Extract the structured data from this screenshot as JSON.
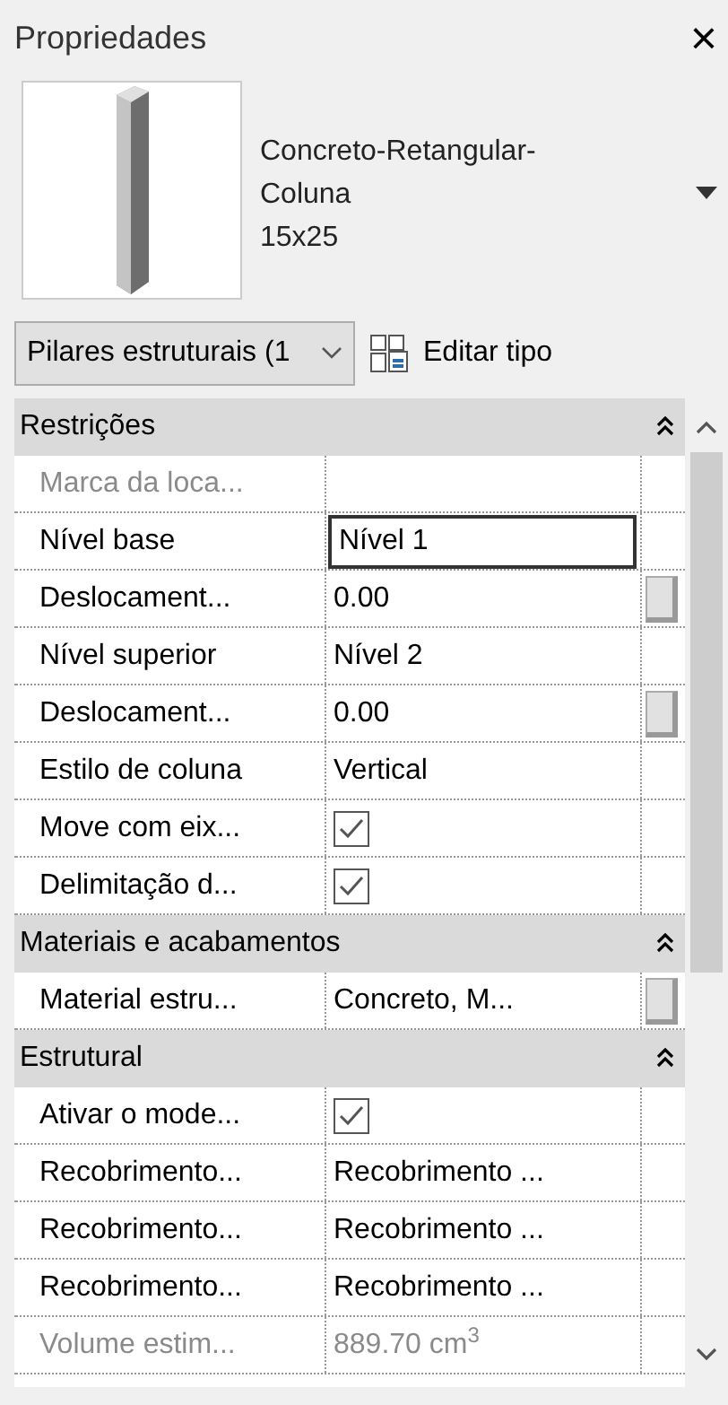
{
  "panel": {
    "title": "Propriedades",
    "close": "×"
  },
  "type_preview": {
    "name": "Concreto-Retangular-Coluna",
    "size": "15x25"
  },
  "selector": {
    "value": "Pilares estruturais (1",
    "edit_type": "Editar tipo"
  },
  "sections": [
    {
      "title": "Restrições",
      "expanded": true,
      "rows": [
        {
          "kind": "text",
          "label": "Marca da loca...",
          "value": "",
          "disabled": true,
          "button": false
        },
        {
          "kind": "field",
          "label": "Nível base",
          "value": "Nível 1",
          "disabled": false,
          "button": false
        },
        {
          "kind": "text",
          "label": "Deslocament...",
          "value": "0.00",
          "disabled": false,
          "button": true
        },
        {
          "kind": "text",
          "label": "Nível superior",
          "value": "Nível 2",
          "disabled": false,
          "button": false
        },
        {
          "kind": "text",
          "label": "Deslocament...",
          "value": "0.00",
          "disabled": false,
          "button": true
        },
        {
          "kind": "text",
          "label": "Estilo de coluna",
          "value": "Vertical",
          "disabled": false,
          "button": false
        },
        {
          "kind": "checkbox",
          "label": "Move com eix...",
          "checked": true,
          "disabled": false,
          "button": false
        },
        {
          "kind": "checkbox",
          "label": "Delimitação d...",
          "checked": true,
          "disabled": false,
          "button": false
        }
      ]
    },
    {
      "title": "Materiais e acabamentos",
      "expanded": true,
      "rows": [
        {
          "kind": "text",
          "label": "Material estru...",
          "value": "Concreto, M...",
          "disabled": false,
          "button": true
        }
      ]
    },
    {
      "title": "Estrutural",
      "expanded": true,
      "rows": [
        {
          "kind": "checkbox",
          "label": "Ativar o mode...",
          "checked": true,
          "disabled": false,
          "button": false
        },
        {
          "kind": "text",
          "label": "Recobrimento...",
          "value": "Recobrimento ...",
          "disabled": false,
          "button": false
        },
        {
          "kind": "text",
          "label": "Recobrimento...",
          "value": "Recobrimento ...",
          "disabled": false,
          "button": false
        },
        {
          "kind": "text",
          "label": "Recobrimento...",
          "value": "Recobrimento ...",
          "disabled": false,
          "button": false
        },
        {
          "kind": "text",
          "label": "Volume estim...",
          "value": "889.70 cm$^{3}$",
          "disabled": true,
          "button": false
        }
      ]
    }
  ]
}
